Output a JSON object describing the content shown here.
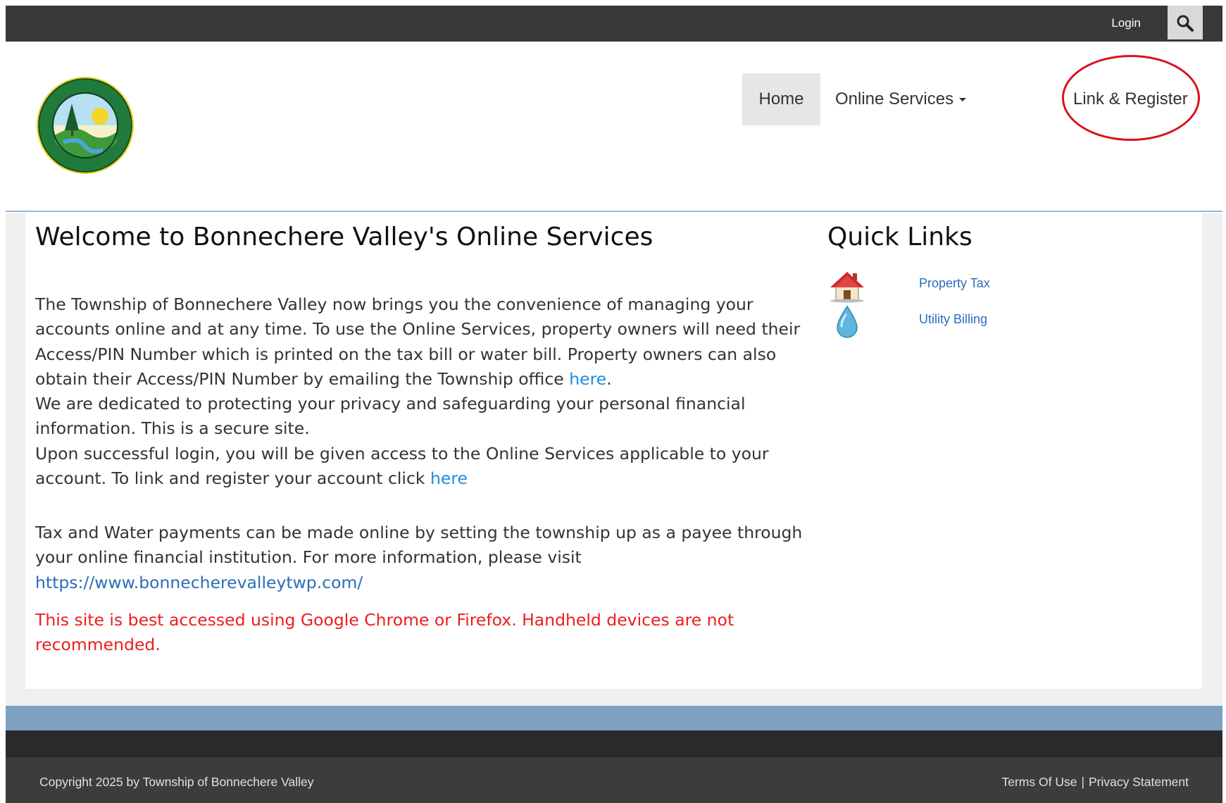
{
  "topbar": {
    "login_label": "Login"
  },
  "nav": {
    "home_label": "Home",
    "services_label": "Online Services",
    "register_label": "Link & Register"
  },
  "main": {
    "title": "Welcome to Bonnechere Valley's Online Services",
    "para1_a": "The Township of Bonnechere Valley now brings you the convenience of managing your accounts online and at any time. To use the Online Services, property owners will need their Access/PIN Number which is printed on the tax bill or water bill. Property owners can also obtain their Access/PIN Number by emailing the Township office ",
    "para1_link": "here",
    "para1_b": ".",
    "para1_c": "We are dedicated to protecting your privacy and safeguarding your personal financial information. This is a secure site.",
    "para1_d": "Upon successful login, you will be given access to the Online Services applicable to your account. To link and register your account click ",
    "para1_link2": "here",
    "para2": "Tax and Water payments can be made online by setting the township up as a payee through your online financial institution.  For more information, please visit",
    "para2_url": "https://www.bonnecherevalleytwp.com/",
    "warning": "This site is best accessed using Google Chrome or Firefox. Handheld devices are not recommended."
  },
  "quick_links": {
    "title": "Quick Links",
    "items": [
      {
        "label": "Property Tax",
        "icon": "house-icon"
      },
      {
        "label": "Utility Billing",
        "icon": "water-drop-icon"
      }
    ]
  },
  "footer": {
    "copyright": "Copyright 2025 by Township of Bonnechere Valley",
    "terms_label": "Terms Of Use",
    "separator": "|",
    "privacy_label": "Privacy Statement"
  },
  "colors": {
    "topbar": "#393939",
    "link": "#1d8be0",
    "warning": "#ee1c1c",
    "annotation_circle": "#d9121e",
    "blue_band": "#7da0c3"
  }
}
